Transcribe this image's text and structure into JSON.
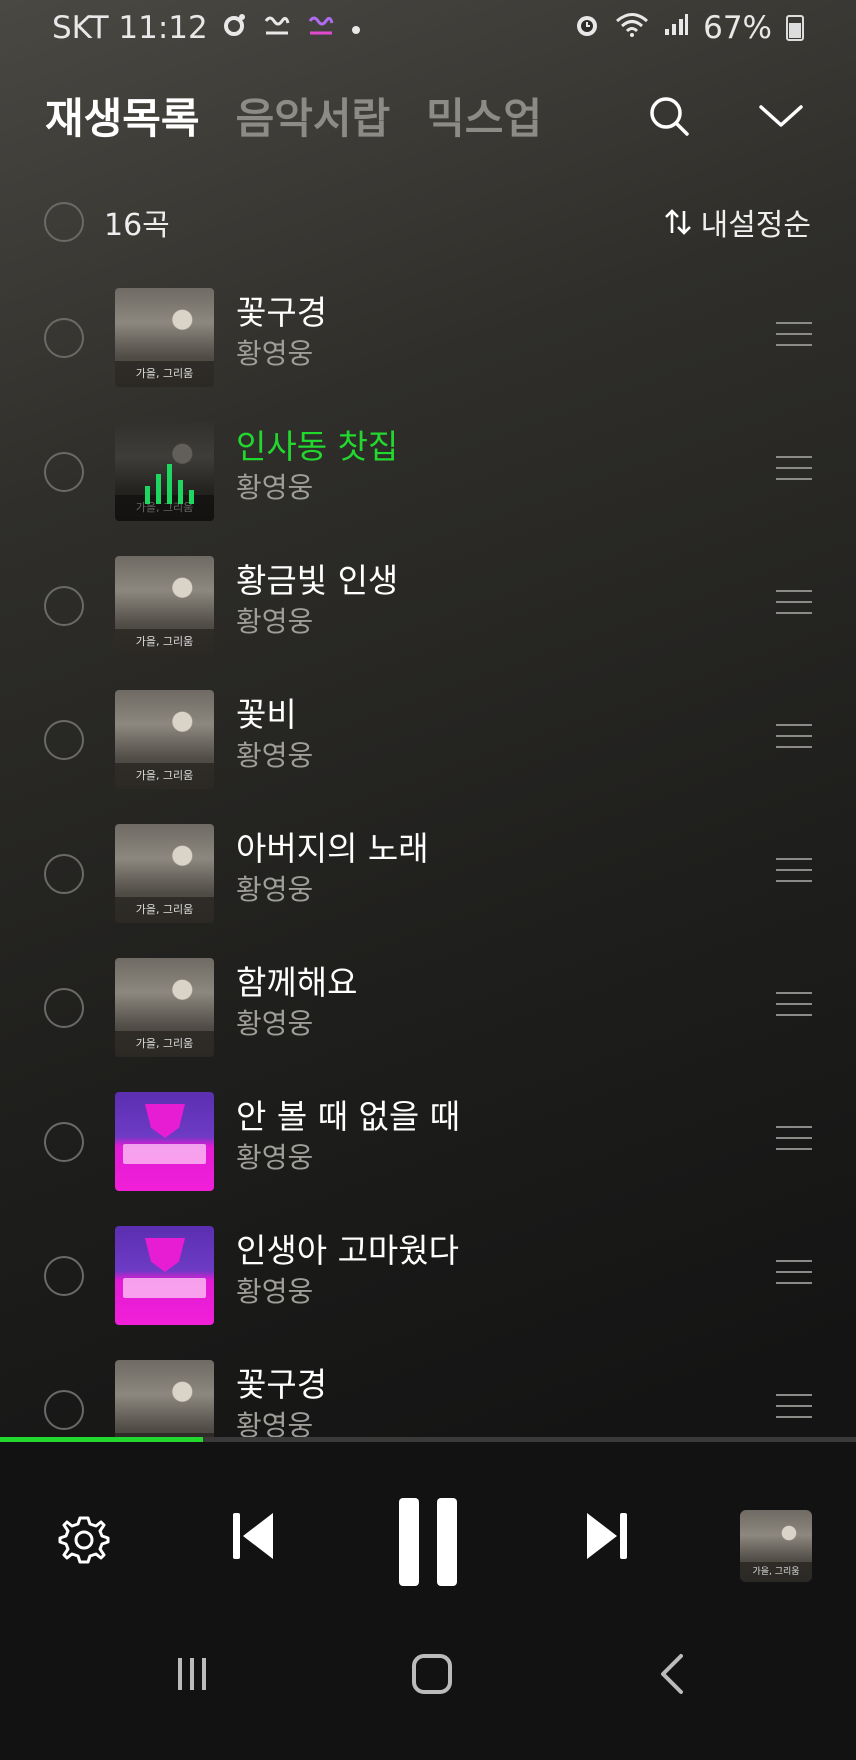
{
  "status": {
    "carrier_time": "SKT 11:12",
    "battery": "67%"
  },
  "tabs": [
    {
      "label": "재생목록",
      "active": true
    },
    {
      "label": "음악서랍",
      "active": false
    },
    {
      "label": "믹스업",
      "active": false
    }
  ],
  "list_header": {
    "count": "16곡",
    "sort": "내설정순"
  },
  "tracks": [
    {
      "title": "꽃구경",
      "artist": "황영웅",
      "art": "album-a",
      "playing": false
    },
    {
      "title": "인사동 찻집",
      "artist": "황영웅",
      "art": "album-a",
      "playing": true
    },
    {
      "title": "황금빛 인생",
      "artist": "황영웅",
      "art": "album-a",
      "playing": false
    },
    {
      "title": "꽃비",
      "artist": "황영웅",
      "art": "album-a",
      "playing": false
    },
    {
      "title": "아버지의 노래",
      "artist": "황영웅",
      "art": "album-a",
      "playing": false
    },
    {
      "title": "함께해요",
      "artist": "황영웅",
      "art": "album-a",
      "playing": false
    },
    {
      "title": "안 볼 때 없을 때",
      "artist": "황영웅",
      "art": "album-b",
      "playing": false
    },
    {
      "title": "인생아 고마웠다",
      "artist": "황영웅",
      "art": "album-b",
      "playing": false
    },
    {
      "title": "꽃구경",
      "artist": "황영웅",
      "art": "album-a",
      "playing": false
    }
  ],
  "album_caption": "가을, 그리움",
  "playback": {
    "progress_fraction": 0.237
  },
  "colors": {
    "accent": "#22d82f",
    "muted": "#a09e99",
    "inactive_tab": "#8d8b86"
  },
  "icons": [
    "search-icon",
    "chevron-down-icon",
    "sort-icon",
    "drag-handle-icon",
    "settings-icon",
    "previous-icon",
    "pause-icon",
    "next-icon",
    "recents-icon",
    "home-icon",
    "back-icon"
  ]
}
